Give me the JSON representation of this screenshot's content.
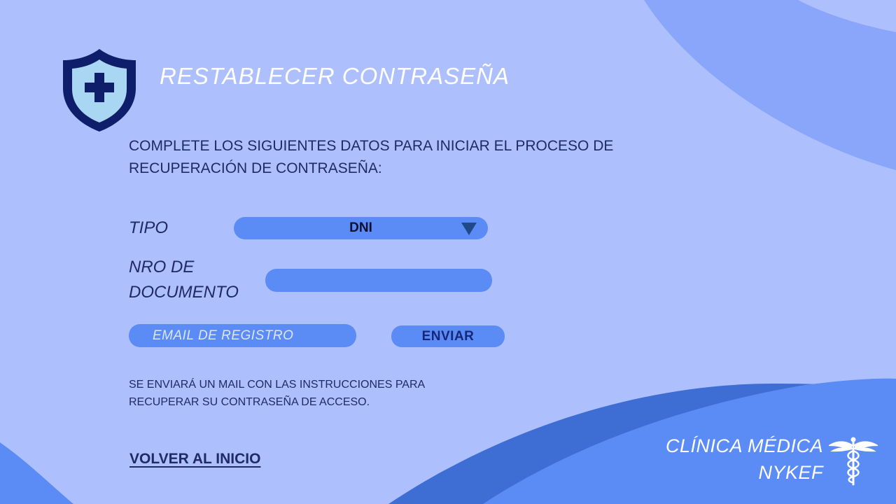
{
  "page": {
    "title": "RESTABLECER CONTRASEÑA",
    "instructions": "COMPLETE LOS SIGUIENTES DATOS PARA INICIAR EL PROCESO DE RECUPERACIÓN DE CONTRASEÑA:"
  },
  "form": {
    "tipo_label": "TIPO",
    "tipo_value": "DNI",
    "documento_label_line1": "NRO DE",
    "documento_label_line2": "DOCUMENTO",
    "documento_value": "",
    "email_placeholder": "EMAIL DE REGISTRO",
    "email_value": "",
    "send_label": "ENVIAR"
  },
  "note": "SE ENVIARÁ UN MAIL CON LAS INSTRUCCIONES PARA RECUPERAR SU CONTRASEÑA DE ACCESO.",
  "links": {
    "home": "VOLVER AL INICIO"
  },
  "clinic": {
    "line1": "CLÍNICA MÉDICA",
    "line2": "NYKEF"
  },
  "icons": {
    "logo": "shield-cross-icon",
    "select_arrow": "triangle-down-icon",
    "clinic_logo": "caduceus-icon"
  },
  "colors": {
    "background": "#adc0fd",
    "field_fill": "#5b8cf5",
    "text_dark": "#1f2a66",
    "shield_outline": "#0f1e6b",
    "shield_fill": "#a9d6f2"
  }
}
